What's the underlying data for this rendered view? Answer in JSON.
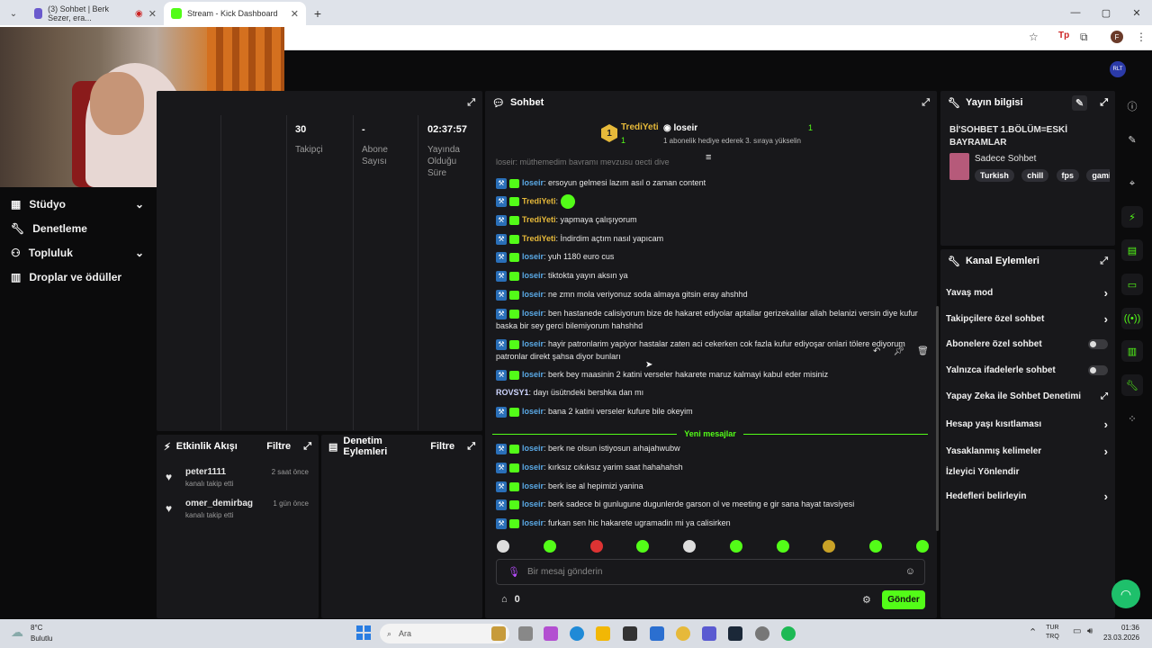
{
  "browser": {
    "tabs": [
      {
        "title": "(3) Sohbet | Berk Sezer, era..."
      },
      {
        "title": "Stream - Kick Dashboard"
      }
    ],
    "new_tab": "+",
    "profile_initial": "F"
  },
  "nav_avatar": "RLT",
  "sidebar": {
    "items": [
      {
        "label": "Stüdyo",
        "icon": "studio-icon",
        "chevron": "⌄"
      },
      {
        "label": "Denetleme",
        "icon": "wrench-icon"
      },
      {
        "label": "Topluluk",
        "icon": "community-icon",
        "chevron": "⌄"
      },
      {
        "label": "Droplar ve ödüller",
        "icon": "chart-icon"
      }
    ]
  },
  "stats": [
    {
      "value": "30",
      "label": "Takipçi"
    },
    {
      "value": "-",
      "label": "Abone Sayısı"
    },
    {
      "value": "02:37:57",
      "label": "Yayında Olduğu Süre"
    }
  ],
  "activity": {
    "title": "Etkinlik Akışı",
    "filter": "Filtre",
    "items": [
      {
        "user": "peter1111",
        "action": "kanalı takip etti",
        "time": "2 saat önce"
      },
      {
        "user": "omer_demirbag",
        "action": "kanalı takip etti",
        "time": "1 gün önce"
      }
    ]
  },
  "moderation": {
    "title": "Denetim Eylemleri",
    "filter": "Filtre"
  },
  "chat": {
    "title": "Sohbet",
    "top_user": "TrediYeti",
    "top_user_count": "1",
    "second_user": "loseir",
    "second_count": "1",
    "gift_text": "1 abonelik hediye ederek 3. sıraya yükselin",
    "partial_line": "loseir: müthemedim bayramı mevzusu geçti diye",
    "messages": [
      {
        "user": "loseir",
        "text": "ersoyun gelmesi lazım asıl o zaman content"
      },
      {
        "user": "TrediYeti",
        "text": ""
      },
      {
        "user": "TrediYeti",
        "text": "yapmaya çalışıyorum"
      },
      {
        "user": "TrediYeti",
        "text": "İndirdim açtım nasıl yapıcam"
      },
      {
        "user": "loseir",
        "text": "yuh 1180 euro cus"
      },
      {
        "user": "loseir",
        "text": "tiktokta yayın aksın ya"
      },
      {
        "user": "loseir",
        "text": "ne zmn mola veriyonuz soda almaya gitsin eray ahshhd"
      },
      {
        "user": "loseir",
        "text": "ben hastanede calisiyorum bize de hakaret ediyolar aptallar gerizekalılar allah belanizi versin diye kufur baska bir sey gerci bilemiyorum hahshhd"
      },
      {
        "user": "loseir",
        "text": "hayir patronlarim yapiyor hastalar zaten aci cekerken cok fazla kufur ediyoşar onlari tölere ediyorum patronlar direkt şahsa diyor bunları"
      },
      {
        "user": "loseir",
        "text": "berk bey maasinin 2 katini verseler hakarete maruz kalmayi kabul eder misiniz"
      },
      {
        "user": "ROVSY1",
        "text": "dayı üsütndeki bershka dan mı"
      },
      {
        "user": "loseir",
        "text": "bana 2 katini verseler kufure bile okeyim"
      }
    ],
    "new_messages": "Yeni mesajlar",
    "new": [
      {
        "user": "loseir",
        "text": "berk ne olsun istiyosun aıhajahwubw"
      },
      {
        "user": "loseir",
        "text": "kırksız cıkıksız yarim saat hahahahsh"
      },
      {
        "user": "loseir",
        "text": "berk ise al hepimizi yanina"
      },
      {
        "user": "loseir",
        "text": "berk sadece bi gunlugune dugunlerde garson ol ve meeting e gir sana hayat tavsiyesi"
      },
      {
        "user": "loseir",
        "text": "furkan sen hic hakarete ugramadin mi ya calisirken"
      }
    ],
    "input_placeholder": "Bir mesaj gönderin",
    "points": "0",
    "send": "Gönder"
  },
  "stream_info": {
    "title": "Yayın bilgisi",
    "stream_title": "Bİ'SOHBET 1.BÖLÜM=ESKİ BAYRAMLAR",
    "category": "Sadece Sohbet",
    "tags": [
      "Turkish",
      "chill",
      "fps",
      "gami"
    ]
  },
  "channel_actions": {
    "title": "Kanal Eylemleri",
    "items": [
      {
        "label": "Yavaş mod",
        "control": "chevron"
      },
      {
        "label": "Takipçilere özel sohbet",
        "control": "chevron"
      },
      {
        "label": "Abonelere özel sohbet",
        "control": "toggle"
      },
      {
        "label": "Yalnızca ifadelerle sohbet",
        "control": "toggle"
      },
      {
        "label": "Yapay Zeka ile Sohbet Denetimi",
        "control": "external"
      },
      {
        "label": "Hesap yaşı kısıtlaması",
        "control": "chevron"
      },
      {
        "label": "Yasaklanmış kelimeler",
        "control": "chevron"
      },
      {
        "label": "İzleyici Yönlendir",
        "control": "none"
      },
      {
        "label": "Hedefleri belirleyin",
        "control": "chevron"
      }
    ]
  },
  "taskbar": {
    "weather_temp": "8°C",
    "weather_desc": "Bulutlu",
    "search": "Ara",
    "lang1": "TUR",
    "lang2": "TRQ",
    "time": "01:36",
    "date": "23.03.2026"
  },
  "colors": {
    "accent": "#53fc18",
    "panel": "#18181b",
    "bg": "#0b0b0c"
  }
}
